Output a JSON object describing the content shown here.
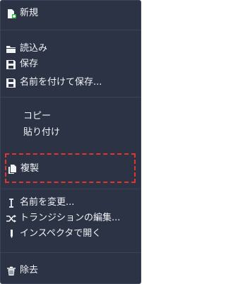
{
  "menu": {
    "items": {
      "new": {
        "label": "新規",
        "icon": "new-file-icon"
      },
      "load": {
        "label": "読込み",
        "icon": "folder-icon"
      },
      "save": {
        "label": "保存",
        "icon": "save-icon"
      },
      "save_as": {
        "label": "名前を付けて保存...",
        "icon": "save-icon"
      },
      "copy": {
        "label": "コピー"
      },
      "paste": {
        "label": "貼り付け"
      },
      "duplicate": {
        "label": "複製",
        "icon": "duplicate-icon"
      },
      "rename": {
        "label": "名前を変更...",
        "icon": "text-cursor-icon"
      },
      "edit_transitions": {
        "label": "トランジションの編集...",
        "icon": "shuffle-icon"
      },
      "open_inspector": {
        "label": "インスペクタで開く",
        "icon": "pen-icon"
      },
      "remove": {
        "label": "除去",
        "icon": "trash-icon"
      }
    },
    "highlight_color": "#e03530",
    "background_color": "#2b3345"
  }
}
